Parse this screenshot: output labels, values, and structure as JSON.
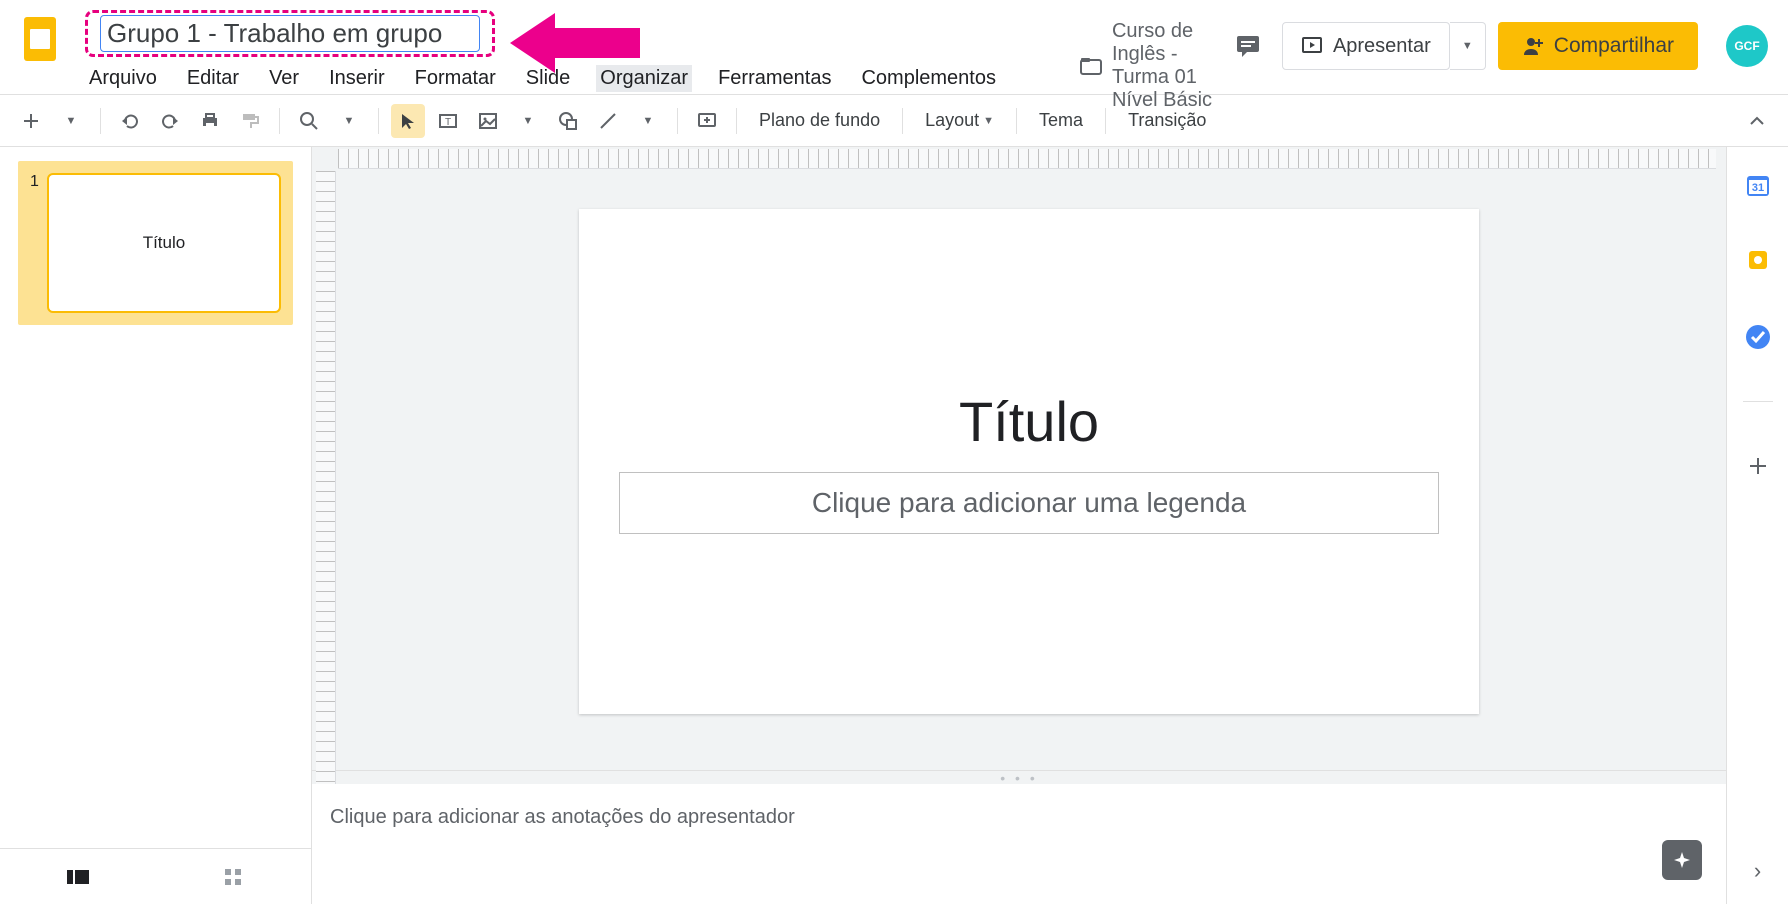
{
  "doc_title": "Grupo 1 - Trabalho em grupo",
  "folder_path": "Curso de Inglês - Turma 01 Nível Básic",
  "menus": [
    "Arquivo",
    "Editar",
    "Ver",
    "Inserir",
    "Formatar",
    "Slide",
    "Organizar",
    "Ferramentas",
    "Complementos"
  ],
  "btn": {
    "present": "Apresentar",
    "share": "Compartilhar"
  },
  "avatar": "GCF",
  "toolbar": {
    "background": "Plano de fundo",
    "layout": "Layout",
    "theme": "Tema",
    "transition": "Transição"
  },
  "filmstrip": {
    "slides": [
      {
        "num": "1",
        "label": "Título"
      }
    ]
  },
  "slide": {
    "title": "Título",
    "subtitle_placeholder": "Clique para adicionar uma legenda"
  },
  "notes_placeholder": "Clique para adicionar as anotações do apresentador"
}
